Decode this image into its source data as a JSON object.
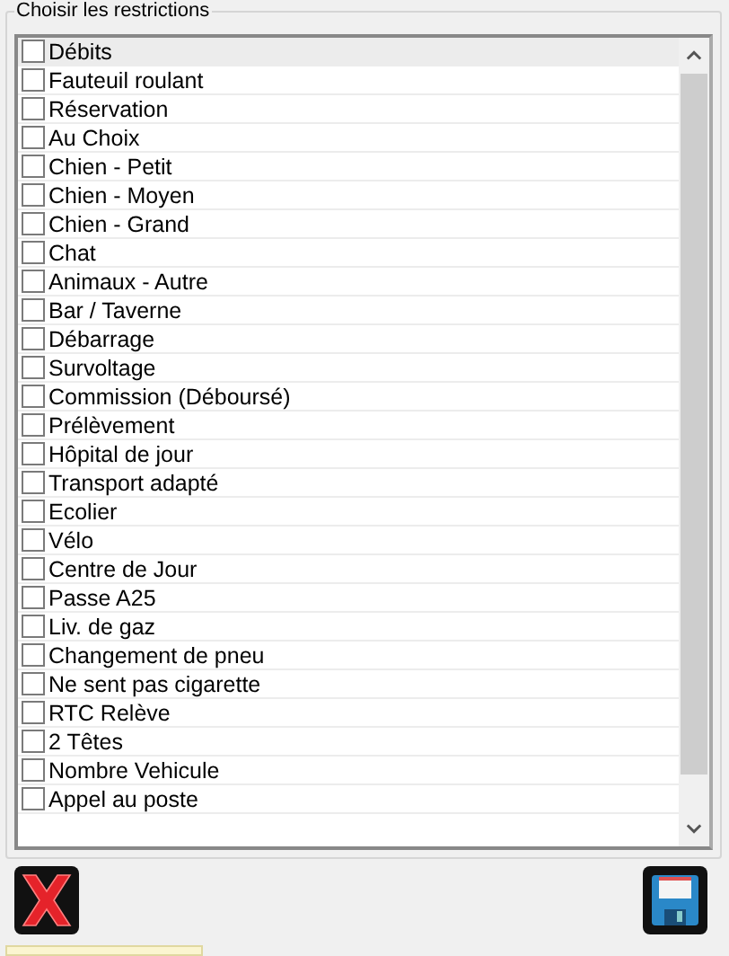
{
  "group": {
    "title": "Choisir les restrictions"
  },
  "restrictions": [
    {
      "label": "Débits",
      "checked": false,
      "selected": true
    },
    {
      "label": "Fauteuil roulant",
      "checked": false,
      "selected": false
    },
    {
      "label": "Réservation",
      "checked": false,
      "selected": false
    },
    {
      "label": "Au Choix",
      "checked": false,
      "selected": false
    },
    {
      "label": "Chien - Petit",
      "checked": false,
      "selected": false
    },
    {
      "label": "Chien - Moyen",
      "checked": false,
      "selected": false
    },
    {
      "label": "Chien - Grand",
      "checked": false,
      "selected": false
    },
    {
      "label": "Chat",
      "checked": false,
      "selected": false
    },
    {
      "label": "Animaux - Autre",
      "checked": false,
      "selected": false
    },
    {
      "label": "Bar / Taverne",
      "checked": false,
      "selected": false
    },
    {
      "label": "Débarrage",
      "checked": false,
      "selected": false
    },
    {
      "label": "Survoltage",
      "checked": false,
      "selected": false
    },
    {
      "label": "Commission (Déboursé)",
      "checked": false,
      "selected": false
    },
    {
      "label": "Prélèvement",
      "checked": false,
      "selected": false
    },
    {
      "label": "Hôpital de jour",
      "checked": false,
      "selected": false
    },
    {
      "label": "Transport adapté",
      "checked": false,
      "selected": false
    },
    {
      "label": "Ecolier",
      "checked": false,
      "selected": false
    },
    {
      "label": "Vélo",
      "checked": false,
      "selected": false
    },
    {
      "label": "Centre de Jour",
      "checked": false,
      "selected": false
    },
    {
      "label": "Passe A25",
      "checked": false,
      "selected": false
    },
    {
      "label": "Liv. de gaz",
      "checked": false,
      "selected": false
    },
    {
      "label": "Changement de pneu",
      "checked": false,
      "selected": false
    },
    {
      "label": "Ne sent pas cigarette",
      "checked": false,
      "selected": false
    },
    {
      "label": "RTC Relève",
      "checked": false,
      "selected": false
    },
    {
      "label": "2 Têtes",
      "checked": false,
      "selected": false
    },
    {
      "label": "Nombre Vehicule",
      "checked": false,
      "selected": false
    },
    {
      "label": "Appel au poste",
      "checked": false,
      "selected": false
    }
  ]
}
